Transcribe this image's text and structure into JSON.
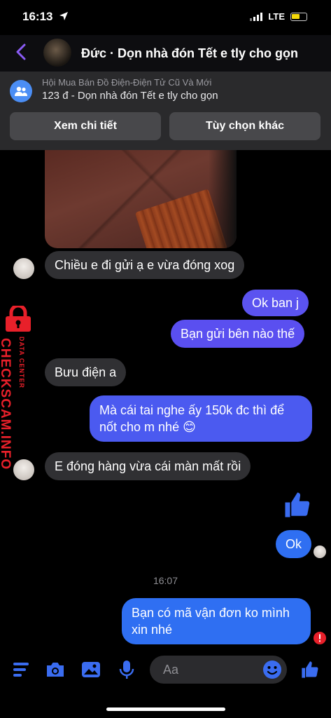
{
  "status": {
    "time": "16:13",
    "network": "LTE"
  },
  "header": {
    "title": "Đức · Dọn nhà đón Tết e tly cho gọn"
  },
  "listing": {
    "group": "Hội Mua Bán Đồ Điện-Điện Tử Cũ Và Mới",
    "summary": "123 đ - Dọn nhà đón Tết e tly cho gọn",
    "view_details": "Xem chi tiết",
    "more_options": "Tùy chọn khác"
  },
  "messages": {
    "m1": "Chiều e đi gửi ạ e vừa đóng xog",
    "m2": "Ok ban j",
    "m3": "Bạn gửi bên nào thế",
    "m4": "Bưu điện a",
    "m5a": "Mà cái tai nghe ấy 150k đc thì để",
    "m5b": "nốt cho m nhé 😊",
    "m6": "E đóng hàng vừa cái màn mất rồi",
    "m7": "Ok",
    "timestamp": "16:07",
    "m8a": "Bạn có mã vận đơn ko mình",
    "m8b": "xin nhé"
  },
  "watermark": {
    "brand": "CHECKSCAM.INFO",
    "tag": "DATA CENTER"
  },
  "composer": {
    "placeholder": "Aa"
  },
  "colors": {
    "accent": "#5b53f0",
    "outgoing": "#5b4df0",
    "outgoing_blue": "#2f6ff2",
    "alert": "#e8202a"
  },
  "icons": [
    "back-icon",
    "group-icon",
    "menu-icon",
    "camera-icon",
    "gallery-icon",
    "mic-icon",
    "emoji-icon",
    "like-icon",
    "error-icon"
  ]
}
